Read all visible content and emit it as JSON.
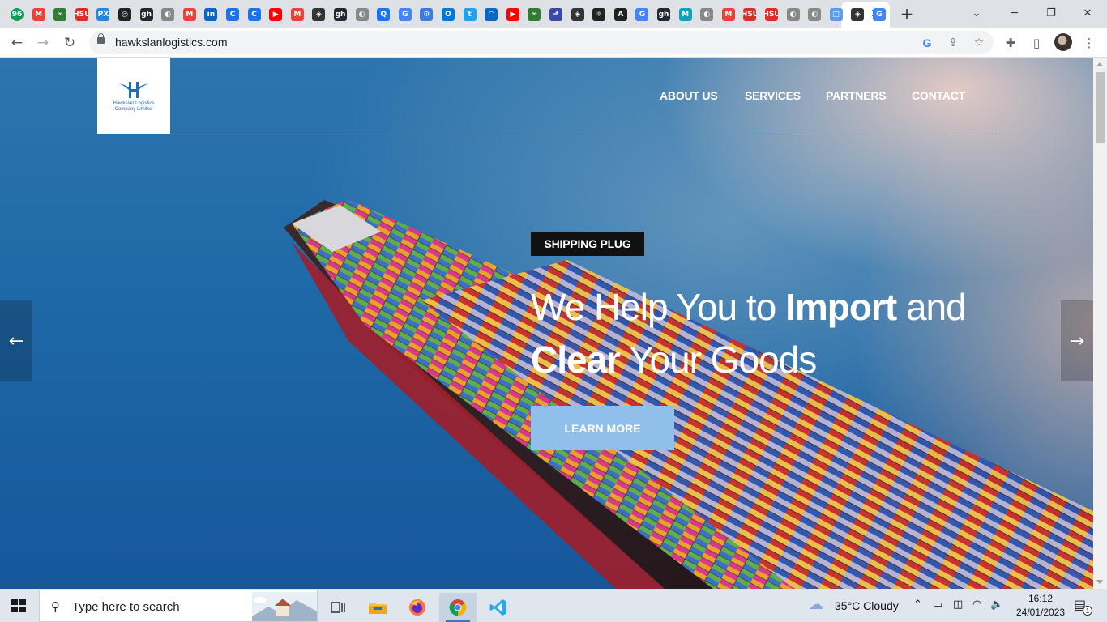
{
  "browser": {
    "tab_badge": "96",
    "tab_favicons": [
      "96",
      "M",
      "∞",
      "HSU",
      "PX",
      "◎",
      "gh",
      "◐",
      "M",
      "in",
      "C",
      "C",
      "▶",
      "M",
      "◈",
      "gh",
      "◐",
      "Q",
      "G",
      "⚙",
      "O",
      "t",
      "◠",
      "▶",
      "∞",
      "⬏",
      "◈",
      "⚛",
      "A",
      "G",
      "gh",
      "M",
      "◐",
      "M",
      "HSU",
      "HSU",
      "◐",
      "◐",
      "◫",
      "◈",
      "G"
    ],
    "new_tab": "+",
    "close_tab": "✕",
    "url": "hawkslanlogistics.com",
    "window_controls": {
      "minimize": "─",
      "restore": "❐",
      "close": "✕",
      "tabsearch": "⌄"
    }
  },
  "site": {
    "logo_text": "Hawkslan Logistics Company Limited",
    "nav": [
      "ABOUT US",
      "SERVICES",
      "PARTNERS",
      "CONTACT"
    ],
    "hero": {
      "kicker": "SHIPPING PLUG",
      "line1_pre": "We Help You to ",
      "line1_bold": "Import",
      "line1_post": " and",
      "line2_bold": "Clear",
      "line2_post": " Your Goods",
      "cta": "LEARN MORE",
      "prev_arrow": "←",
      "next_arrow": "→"
    }
  },
  "taskbar": {
    "search_placeholder": "Type here to search",
    "weather": "35°C  Cloudy",
    "time": "16:12",
    "date": "24/01/2023",
    "notification_count": "1"
  },
  "colors": {
    "accent": "#8fbfea",
    "kicker_bg": "#111111",
    "brand_blue": "#1b6fb8"
  }
}
